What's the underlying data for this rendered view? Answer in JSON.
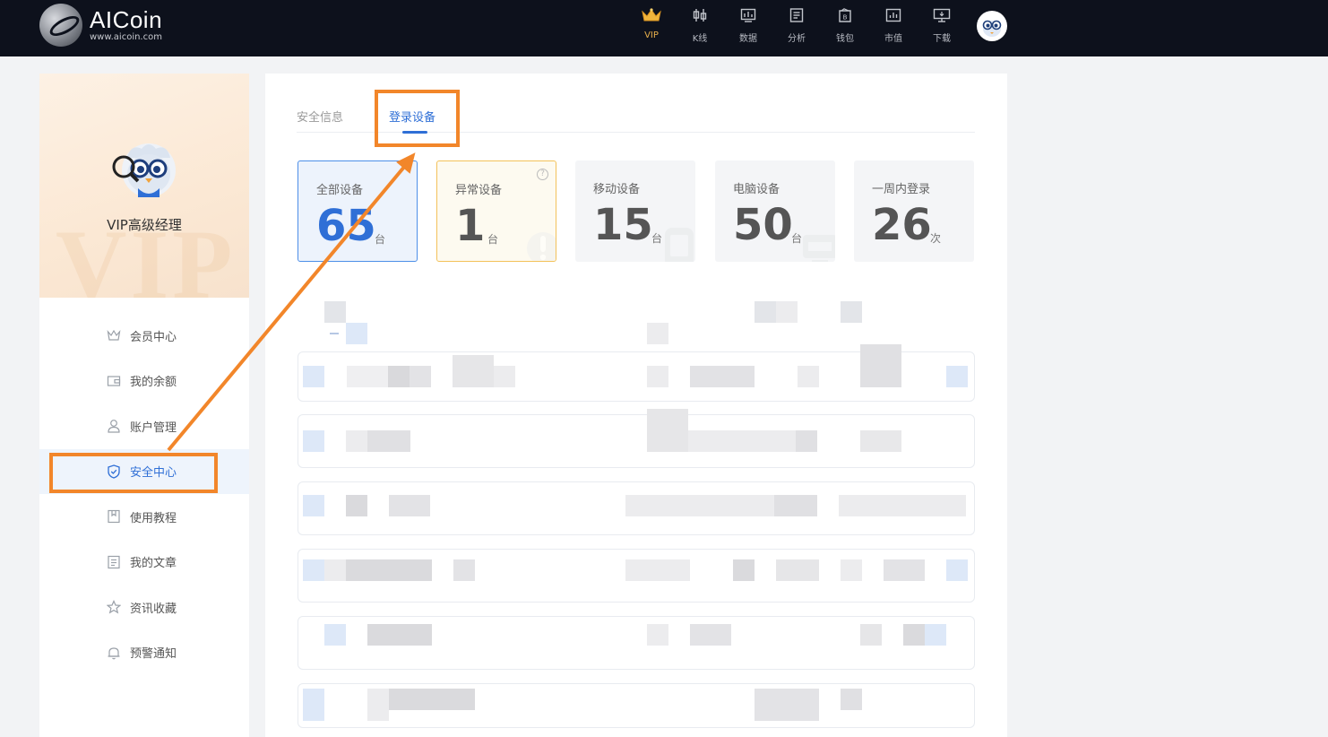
{
  "header": {
    "logo_title": "AICoin",
    "logo_url": "www.aicoin.com",
    "nav": [
      {
        "label": "VIP",
        "icon": "crown-icon"
      },
      {
        "label": "K线",
        "icon": "candlestick-icon"
      },
      {
        "label": "数据",
        "icon": "data-chart-icon"
      },
      {
        "label": "分析",
        "icon": "analysis-icon"
      },
      {
        "label": "钱包",
        "icon": "wallet-icon"
      },
      {
        "label": "市值",
        "icon": "market-cap-icon"
      },
      {
        "label": "下载",
        "icon": "download-monitor-icon"
      }
    ]
  },
  "sidebar": {
    "watermark": "VIP",
    "profile_name": "VIP高级经理",
    "items": [
      {
        "label": "会员中心",
        "icon": "crown-icon"
      },
      {
        "label": "我的余额",
        "icon": "wallet-icon"
      },
      {
        "label": "账户管理",
        "icon": "user-icon"
      },
      {
        "label": "安全中心",
        "icon": "shield-icon",
        "active": true
      },
      {
        "label": "使用教程",
        "icon": "bookmark-icon"
      },
      {
        "label": "我的文章",
        "icon": "document-icon"
      },
      {
        "label": "资讯收藏",
        "icon": "star-icon"
      },
      {
        "label": "预警通知",
        "icon": "bell-icon"
      }
    ]
  },
  "main": {
    "tabs": [
      {
        "label": "安全信息",
        "active": false
      },
      {
        "label": "登录设备",
        "active": true
      }
    ],
    "cards": [
      {
        "label": "全部设备",
        "value": "65",
        "unit": "台"
      },
      {
        "label": "异常设备",
        "value": "1",
        "unit": "台"
      },
      {
        "label": "移动设备",
        "value": "15",
        "unit": "台"
      },
      {
        "label": "电脑设备",
        "value": "50",
        "unit": "台"
      },
      {
        "label": "一周内登录",
        "value": "26",
        "unit": "次"
      }
    ],
    "help_mark": "?"
  },
  "colors": {
    "accent": "#2f6fd6",
    "annotation": "#f2862a",
    "header_bg": "#0d111c",
    "warning_border": "#f3c25a"
  }
}
